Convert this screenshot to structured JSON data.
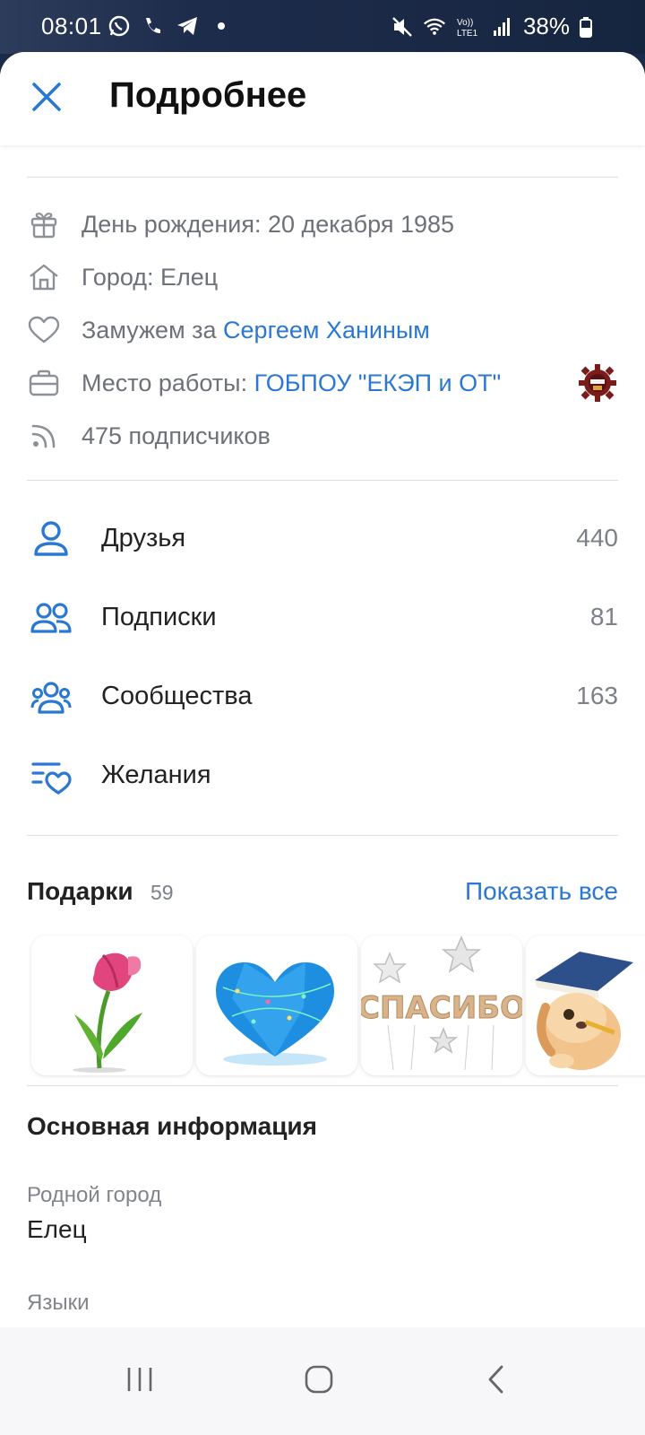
{
  "status_bar": {
    "time": "08:01",
    "battery": "38%",
    "network_label": "Vo)) LTE1"
  },
  "header": {
    "title": "Подробнее"
  },
  "info": {
    "birthday": "День рождения: 20 декабря 1985",
    "city": "Город: Елец",
    "married_prefix": "Замужем за",
    "married_link": "Сергеем Ханиным",
    "work_prefix": "Место работы:",
    "work_link": "ГОБПОУ \"ЕКЭП и ОТ\"",
    "followers": "475 подписчиков"
  },
  "menu": {
    "friends_label": "Друзья",
    "friends_count": "440",
    "subscriptions_label": "Подписки",
    "subscriptions_count": "81",
    "communities_label": "Сообщества",
    "communities_count": "163",
    "wishes_label": "Желания"
  },
  "gifts": {
    "title": "Подарки",
    "count": "59",
    "show_all": "Показать все",
    "items": [
      "tulip",
      "heart",
      "спасибо balloons",
      "puppy with book"
    ],
    "balloon_text": "СПАСИБО"
  },
  "basic_info": {
    "title": "Основная информация",
    "hometown_label": "Родной город",
    "hometown_value": "Елец",
    "languages_label": "Языки"
  },
  "colors": {
    "accent": "#2a78d1",
    "icon_gray": "#8c9097",
    "text_gray": "#6d7178"
  }
}
